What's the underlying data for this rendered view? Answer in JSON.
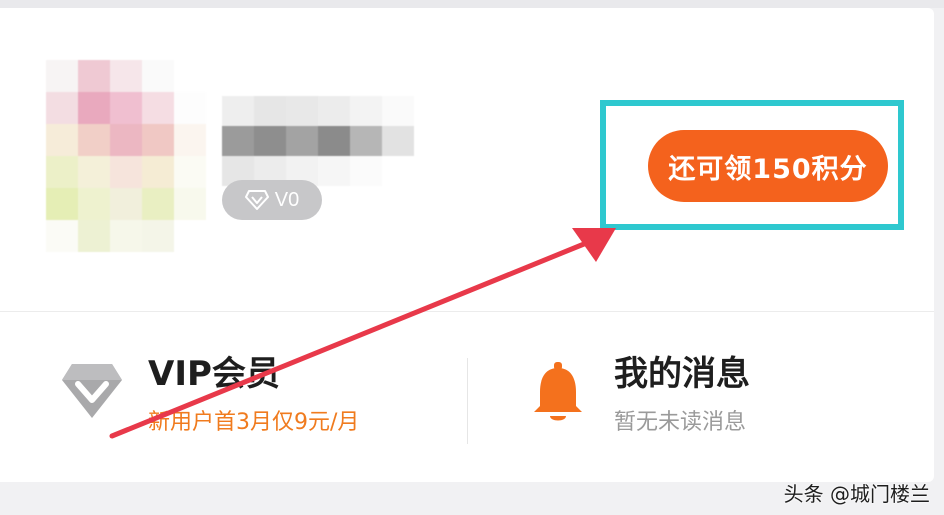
{
  "profile": {
    "level_label": "V0",
    "points_button_label": "还可领150积分"
  },
  "vip": {
    "title": "VIP会员",
    "subtitle": "新用户首3月仅9元/月"
  },
  "messages": {
    "title": "我的消息",
    "subtitle": "暂无未读消息"
  },
  "watermark": "头条 @城门楼兰",
  "icons": {
    "level": "diamond-icon",
    "vip": "diamond-icon",
    "messages": "bell-icon"
  },
  "colors": {
    "accent_orange": "#f4621d",
    "subtitle_orange": "#f07b1e",
    "highlight_cyan": "#2ec8cf",
    "annotation_red": "#e8394a",
    "badge_gray": "#c7c7c9"
  }
}
